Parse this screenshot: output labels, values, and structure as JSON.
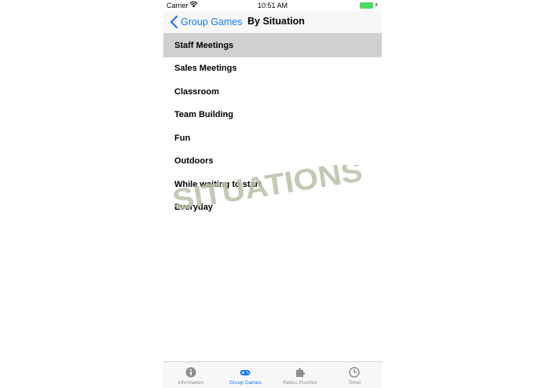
{
  "status_bar": {
    "carrier": "Carrier",
    "time": "10:51 AM"
  },
  "navbar": {
    "back_label": "Group Games",
    "title": "By Situation"
  },
  "list": {
    "items": [
      {
        "label": "Staff Meetings",
        "selected": true
      },
      {
        "label": "Sales Meetings"
      },
      {
        "label": "Classroom"
      },
      {
        "label": "Team Building"
      },
      {
        "label": "Fun"
      },
      {
        "label": "Outdoors"
      },
      {
        "label": "While waiting to start"
      },
      {
        "label": "Everyday"
      }
    ]
  },
  "watermark": {
    "text": "SITUATIONS",
    "color": "#b7c2a8"
  },
  "tabbar": {
    "tabs": [
      {
        "label": "Information",
        "icon": "info-icon"
      },
      {
        "label": "Group Games",
        "icon": "gamepad-icon",
        "active": true
      },
      {
        "label": "Rebus Puzzles",
        "icon": "puzzle-icon"
      },
      {
        "label": "Timer",
        "icon": "clock-icon"
      }
    ]
  },
  "colors": {
    "accent": "#1a7cf4",
    "selected_row": "#d0d0d0",
    "battery": "#4cd964"
  }
}
